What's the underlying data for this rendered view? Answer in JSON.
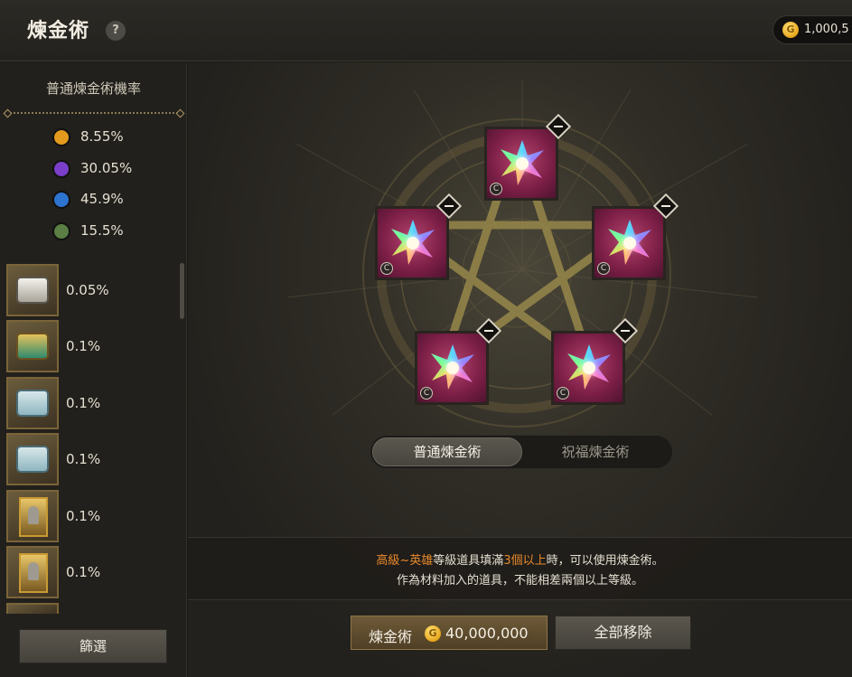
{
  "header": {
    "title": "煉金術",
    "help_icon": "?",
    "currency_amount": "1,000,5",
    "coin_symbol": "G"
  },
  "sidebar": {
    "rate_title": "普通煉金術機率",
    "grade_rates": [
      {
        "color": "#e39a1d",
        "value": "8.55%"
      },
      {
        "color": "#7a3ec8",
        "value": "30.05%"
      },
      {
        "color": "#2d74d1",
        "value": "45.9%"
      },
      {
        "color": "#5a7e43",
        "value": "15.5%"
      }
    ],
    "items": [
      {
        "icon": "white-box-icon",
        "pct": "0.05%"
      },
      {
        "icon": "green-gold-chest-icon",
        "pct": "0.1%"
      },
      {
        "icon": "silver-chest-icon",
        "pct": "0.1%"
      },
      {
        "icon": "silver-chest-icon",
        "pct": "0.1%"
      },
      {
        "icon": "character-card-icon",
        "pct": "0.1%"
      },
      {
        "icon": "character-card-icon",
        "pct": "0.1%"
      }
    ],
    "filter_label": "篩選"
  },
  "slots": [
    {
      "grade_mark": "C"
    },
    {
      "grade_mark": "C"
    },
    {
      "grade_mark": "C"
    },
    {
      "grade_mark": "C"
    },
    {
      "grade_mark": "C"
    }
  ],
  "tabs": {
    "normal": "普通煉金術",
    "blessed": "祝福煉金術",
    "active": "normal"
  },
  "info": {
    "grade_range": "高級~英雄",
    "line1_mid": "等級道具填滿",
    "count_req": "3個以上",
    "line1_end": "時，可以使用煉金術。",
    "line2": "作為材料加入的道具，不能相差兩個以上等級。"
  },
  "buttons": {
    "alchemy_label": "煉金術",
    "alchemy_cost": "40,000,000",
    "remove_all": "全部移除"
  },
  "colors": {
    "accent_orange": "#e98a2c",
    "slot_bg": "#7b1e45"
  }
}
